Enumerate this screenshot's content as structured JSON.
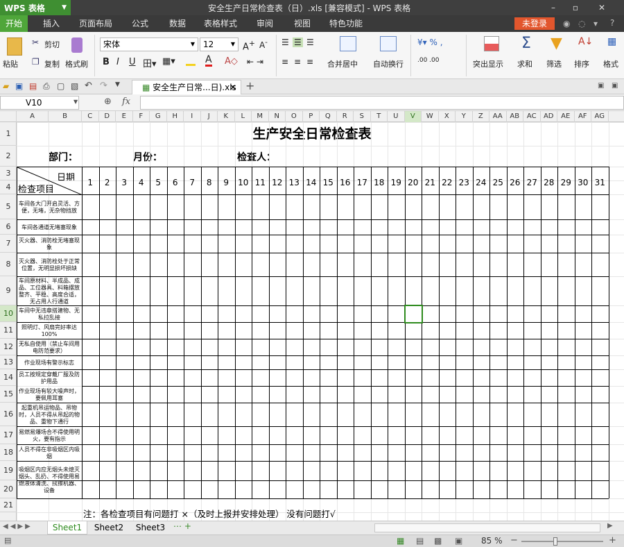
{
  "app": {
    "menu_label": "WPS 表格",
    "window_title": "安全生产日常检查表（日）.xls [兼容模式] - WPS 表格"
  },
  "ribbon": {
    "tabs": [
      "开始",
      "插入",
      "页面布局",
      "公式",
      "数据",
      "表格样式",
      "审阅",
      "视图",
      "特色功能"
    ],
    "active": "开始",
    "login": "未登录"
  },
  "toolbar": {
    "paste": "粘贴",
    "cut": "剪切",
    "copy": "复制",
    "format_painter": "格式刷",
    "font": "宋体",
    "size": "12",
    "merge": "合并居中",
    "wrap": "自动换行",
    "cond_format": "突出显示",
    "sum": "求和",
    "filter": "筛选",
    "sort": "排序",
    "format": "格式"
  },
  "doc_tab": {
    "label": "安全生产日常...日).xls"
  },
  "formula": {
    "cell_ref": "V10",
    "fx": "fx",
    "content": ""
  },
  "columns": [
    "A",
    "B",
    "C",
    "D",
    "E",
    "F",
    "G",
    "H",
    "I",
    "J",
    "K",
    "L",
    "M",
    "N",
    "O",
    "P",
    "Q",
    "R",
    "S",
    "T",
    "U",
    "V",
    "W",
    "X",
    "Y",
    "Z",
    "AA",
    "AB",
    "AC",
    "AD",
    "AE",
    "AF",
    "AG"
  ],
  "rows": [
    "1",
    "2",
    "3",
    "4",
    "5",
    "6",
    "7",
    "8",
    "9",
    "10",
    "11",
    "12",
    "13",
    "14",
    "15",
    "16",
    "17",
    "18",
    "19",
    "20",
    "21"
  ],
  "selected": {
    "column": "V",
    "row": "10"
  },
  "sheet": {
    "title": "生产安全日常检查表",
    "dept_label": "部门：",
    "month_label": "月份：",
    "inspector_label": "检查人：",
    "diag_top": "日期",
    "diag_bottom": "检查项目",
    "days": [
      "1",
      "2",
      "3",
      "4",
      "5",
      "6",
      "7",
      "8",
      "9",
      "10",
      "11",
      "12",
      "13",
      "14",
      "15",
      "16",
      "17",
      "18",
      "19",
      "20",
      "21",
      "22",
      "23",
      "24",
      "25",
      "26",
      "27",
      "28",
      "29",
      "30",
      "31"
    ],
    "items": [
      "车间各大门开启灵活、方便，无堵，无杂物挡放",
      "车间各通道无堵塞现象",
      "灭火器、消防栓无堵塞现象",
      "灭火器、消防栓处于正常位置，无明显损坏损缺",
      "车间原材料、半成品、成品、工位器具、料箱摆放整齐、平稳、高度合适，无占用人行通道",
      "车间中无违章搭建物、无私拉乱接",
      "照明灯、风扇完好率达100%",
      "无私自使用（禁止车间用电防范要求）",
      "作业现场有警示标志",
      "员工按规定穿戴厂服及防护用品",
      "作业现场有较大噪声时，要佩用耳塞",
      "起重机吊运物品、吊物时，人员不得从吊起的物品、重物下通行",
      "易燃易爆场合不得使用明火，要有指示",
      "人员不得在非吸烟区内吸烟",
      "吸烟区内应无烟头未熄灭烟头、乱扔、不得使用易燃液体清洗、拭擦机器、设备"
    ],
    "note": "注：各检查项目有问题打 ×（及时上报并安排处理）  没有问题打√"
  },
  "sheets": [
    "Sheet1",
    "Sheet2",
    "Sheet3"
  ],
  "active_sheet": "Sheet1",
  "status": {
    "zoom": "85 %"
  },
  "colors": {
    "accent": "#4fa63a",
    "selection": "#2e8b1e",
    "titlebar": "#3f3f3f"
  }
}
